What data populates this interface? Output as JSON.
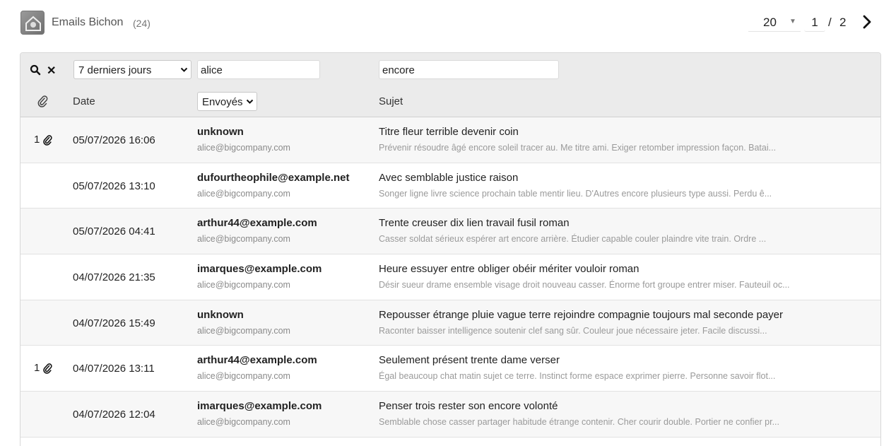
{
  "header": {
    "title": "Emails Bichon",
    "count": "(24)",
    "logo_icon": "bichon-logo-icon"
  },
  "pagination": {
    "per_page": "20",
    "current_page": "1",
    "separator": "/",
    "total_pages": "2",
    "next_icon": "chevron-right-icon"
  },
  "filters": {
    "period_selected": "7 derniers jours",
    "from_value": "alice",
    "subject_value": "encore",
    "direction_selected": "Envoyés"
  },
  "columns": {
    "date": "Date",
    "subject": "Sujet"
  },
  "rows": [
    {
      "attachments": "1",
      "date": "05/07/2026 16:06",
      "from": "unknown",
      "to": "alice@bigcompany.com",
      "subject": "Titre fleur terrible devenir coin",
      "preview": "Prévenir résoudre âgé encore soleil tracer au. Me titre ami. Exiger retomber impression façon. Batai..."
    },
    {
      "attachments": "",
      "date": "05/07/2026 13:10",
      "from": "dufourtheophile@example.net",
      "to": "alice@bigcompany.com",
      "subject": "Avec semblable justice raison",
      "preview": "Songer ligne livre science prochain table mentir lieu. D'Autres encore plusieurs type aussi. Perdu ê..."
    },
    {
      "attachments": "",
      "date": "05/07/2026 04:41",
      "from": "arthur44@example.com",
      "to": "alice@bigcompany.com",
      "subject": "Trente creuser dix lien travail fusil roman",
      "preview": "Casser soldat sérieux espérer art encore arrière. Étudier capable couler plaindre vite train. Ordre ..."
    },
    {
      "attachments": "",
      "date": "04/07/2026 21:35",
      "from": "imarques@example.com",
      "to": "alice@bigcompany.com",
      "subject": "Heure essuyer entre obliger obéir mériter vouloir roman",
      "preview": "Désir sueur drame ensemble visage droit nouveau casser. Énorme fort groupe entrer miser. Fauteuil oc..."
    },
    {
      "attachments": "",
      "date": "04/07/2026 15:49",
      "from": "unknown",
      "to": "alice@bigcompany.com",
      "subject": "Repousser étrange pluie vague terre rejoindre compagnie toujours mal seconde payer",
      "preview": "Raconter baisser intelligence soutenir clef sang sûr. Couleur joue nécessaire jeter. Facile discussi..."
    },
    {
      "attachments": "1",
      "date": "04/07/2026 13:11",
      "from": "arthur44@example.com",
      "to": "alice@bigcompany.com",
      "subject": "Seulement présent trente dame verser",
      "preview": "Égal beaucoup chat matin sujet ce terre. Instinct forme espace exprimer pierre. Personne savoir flot..."
    },
    {
      "attachments": "",
      "date": "04/07/2026 12:04",
      "from": "imarques@example.com",
      "to": "alice@bigcompany.com",
      "subject": "Penser trois rester son encore volonté",
      "preview": "Semblable chose casser partager habitude étrange contenir. Cher courir double. Portier ne confier pr..."
    }
  ]
}
